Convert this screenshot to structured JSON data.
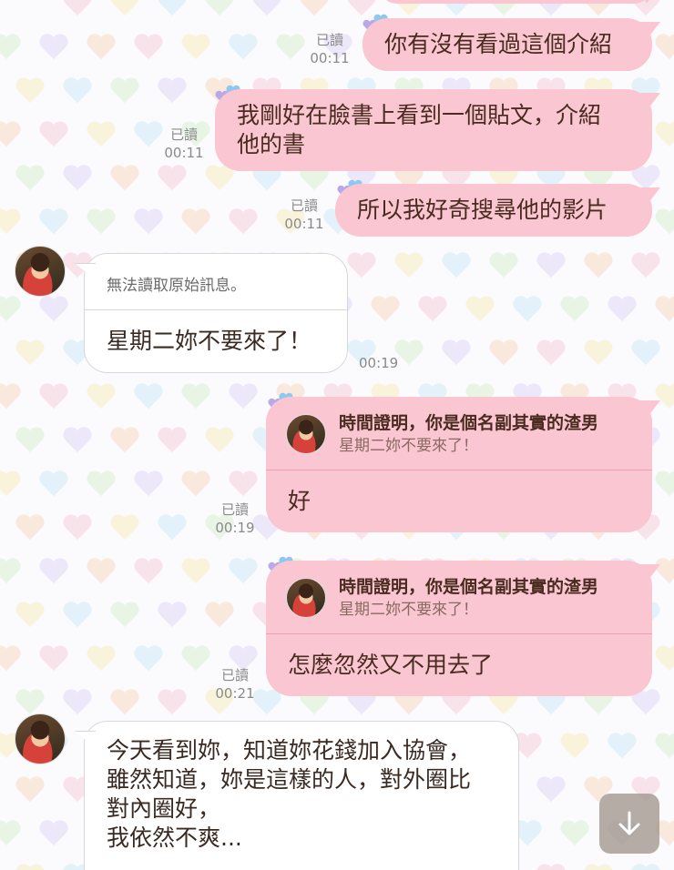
{
  "colors": {
    "outgoing_bubble": "#f9c6d2",
    "incoming_bubble": "#ffffff",
    "text": "#4a2b1f",
    "meta_text": "#8a8a8a",
    "scroll_button": "#a0968c"
  },
  "messages": [
    {
      "direction": "outgoing",
      "text": "你有沒有看過這個介紹",
      "read": "已讀",
      "time": "00:11"
    },
    {
      "direction": "outgoing",
      "text_lines": [
        "我剛好在臉書上看到一個貼文，介紹",
        "他的書"
      ],
      "read": "已讀",
      "time": "00:11"
    },
    {
      "direction": "outgoing",
      "text": "所以我好奇搜尋他的影片",
      "read": "已讀",
      "time": "00:11"
    },
    {
      "direction": "incoming",
      "quoted_notice": "無法讀取原始訊息。",
      "text": "星期二妳不要來了！",
      "time": "00:19"
    },
    {
      "direction": "outgoing",
      "reply_to_name": "時間證明，你是個名副其實的渣男",
      "reply_to_text": "星期二妳不要來了！",
      "text": "好",
      "read": "已讀",
      "time": "00:19"
    },
    {
      "direction": "outgoing",
      "reply_to_name": "時間證明，你是個名副其實的渣男",
      "reply_to_text": "星期二妳不要來了！",
      "text": "怎麼忽然又不用去了",
      "read": "已讀",
      "time": "00:21"
    },
    {
      "direction": "incoming",
      "text_lines": [
        "今天看到妳，知道妳花錢加入協會，",
        "雖然知道，妳是這樣的人，對外圈比",
        "對內圈好，",
        "我依然不爽..."
      ]
    }
  ],
  "scroll_button": {
    "icon": "arrow-down-icon"
  }
}
